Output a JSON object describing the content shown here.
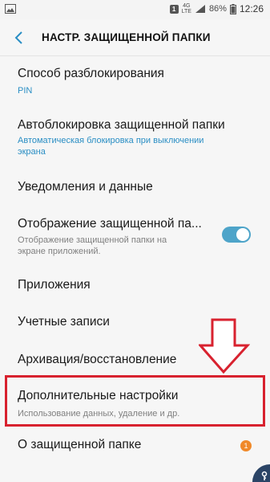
{
  "status_bar": {
    "sim_label": "1",
    "network_type": "4G",
    "network_sub": "LTE",
    "battery": "86%",
    "time": "12:26"
  },
  "header": {
    "title": "НАСТР. ЗАЩИЩЕННОЙ ПАПКИ"
  },
  "settings": [
    {
      "title": "Способ разблокирования",
      "subtitle": "PIN"
    },
    {
      "title": "Автоблокировка защищенной папки",
      "subtitle_line1": "Автоматическая блокировка при выключении",
      "subtitle_line2": "экрана"
    },
    {
      "title": "Уведомления и данные"
    },
    {
      "title": "Отображение защищенной па...",
      "subtitle_line1": "Отображение защищенной папки на",
      "subtitle_line2": "экране приложений.",
      "toggle_on": true
    },
    {
      "title": "Приложения"
    },
    {
      "title": "Учетные записи"
    },
    {
      "title": "Архивация/восстановление"
    },
    {
      "title": "Дополнительные настройки",
      "subtitle": "Использование данных, удаление и др."
    },
    {
      "title": "О защищенной папке",
      "badge": "1"
    }
  ],
  "colors": {
    "accent": "#2a8ec4",
    "toggle": "#4ea4c9",
    "highlight": "#d8222f",
    "badge": "#f0892a"
  }
}
